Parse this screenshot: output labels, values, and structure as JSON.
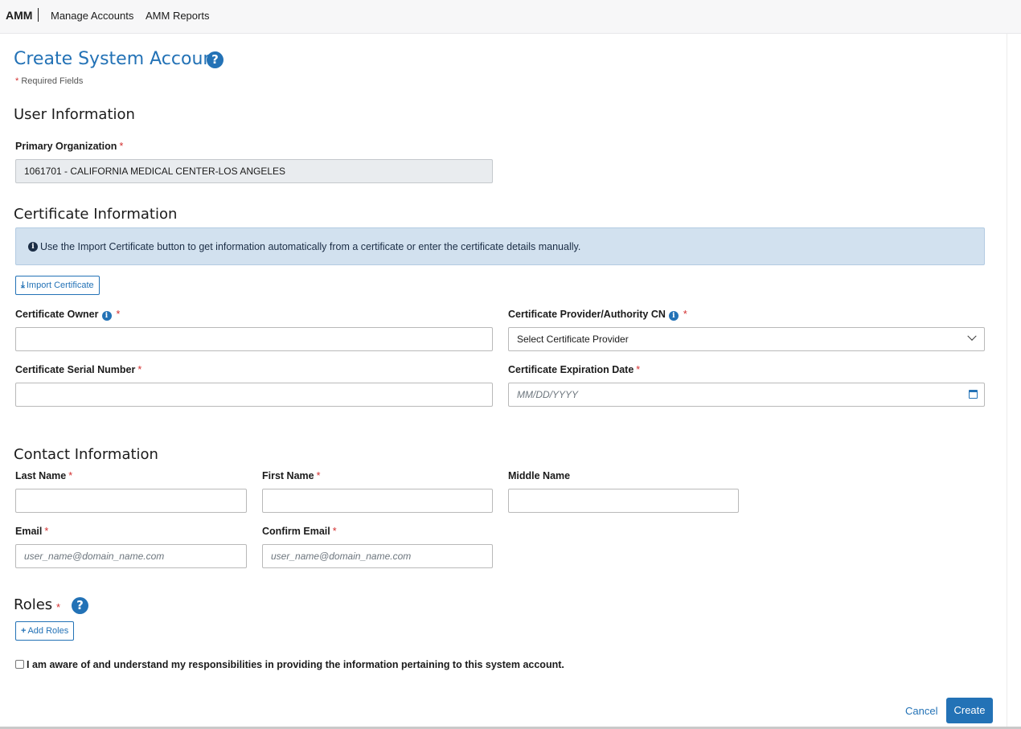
{
  "nav": {
    "brand": "AMM",
    "links": [
      "Manage Accounts",
      "AMM Reports"
    ]
  },
  "page": {
    "title": "Create System Account",
    "required_note": "Required Fields"
  },
  "user_info": {
    "title": "User Information",
    "primary_org_label": "Primary Organization",
    "primary_org_value": "1061701 - CALIFORNIA MEDICAL CENTER-LOS ANGELES"
  },
  "certificate": {
    "title": "Certificate Information",
    "info_text": "Use the Import Certificate button to get information automatically from a certificate or enter the certificate details manually.",
    "import_button": "Import Certificate",
    "owner_label": "Certificate Owner",
    "owner_value": "",
    "provider_label": "Certificate Provider/Authority CN",
    "provider_selected": "Select Certificate Provider",
    "serial_label": "Certificate Serial Number",
    "serial_value": "",
    "expiration_label": "Certificate Expiration Date",
    "expiration_placeholder": "MM/DD/YYYY"
  },
  "contact": {
    "title": "Contact Information",
    "last_name_label": "Last Name",
    "first_name_label": "First Name",
    "middle_name_label": "Middle Name",
    "email_label": "Email",
    "confirm_email_label": "Confirm Email",
    "email_placeholder": "user_name@domain_name.com",
    "confirm_email_placeholder": "user_name@domain_name.com"
  },
  "roles": {
    "title": "Roles",
    "add_button": "Add Roles"
  },
  "agreement": {
    "text": "I am aware of and understand my responsibilities in providing the information pertaining to this system account.",
    "checked": false
  },
  "actions": {
    "cancel": "Cancel",
    "create": "Create"
  },
  "colors": {
    "accent": "#2372b6",
    "required": "#d32f2f",
    "info_bg": "#d2e1ef"
  }
}
